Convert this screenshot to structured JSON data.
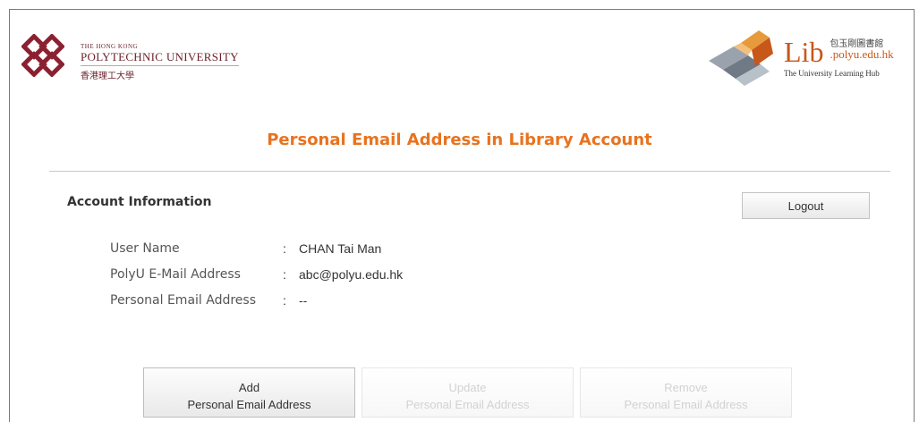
{
  "header": {
    "polyu": {
      "small": "THE HONG KONG",
      "name": "POLYTECHNIC UNIVERSITY",
      "chinese": "香港理工大學"
    },
    "lib": {
      "main": "Lib",
      "chinese": "包玉剛圖書館",
      "url": ".polyu.edu.hk",
      "subtitle": "The University Learning Hub"
    }
  },
  "page_title": "Personal Email Address in Library Account",
  "section": {
    "heading": "Account Information"
  },
  "logout_label": "Logout",
  "account": [
    {
      "label": "User Name",
      "separator": ":",
      "value": "CHAN Tai Man"
    },
    {
      "label": "PolyU E-Mail Address",
      "separator": ":",
      "value": "abc@polyu.edu.hk"
    },
    {
      "label": "Personal Email Address",
      "separator": ":",
      "value": "--"
    }
  ],
  "actions": {
    "add": {
      "line1": "Add",
      "line2": "Personal Email Address"
    },
    "update": {
      "line1": "Update",
      "line2": "Personal Email Address"
    },
    "remove": {
      "line1": "Remove",
      "line2": "Personal Email Address"
    }
  },
  "colors": {
    "title_orange": "#e8731f",
    "polyu_maroon": "#6b1f2a",
    "lib_orange": "#c8571a"
  }
}
